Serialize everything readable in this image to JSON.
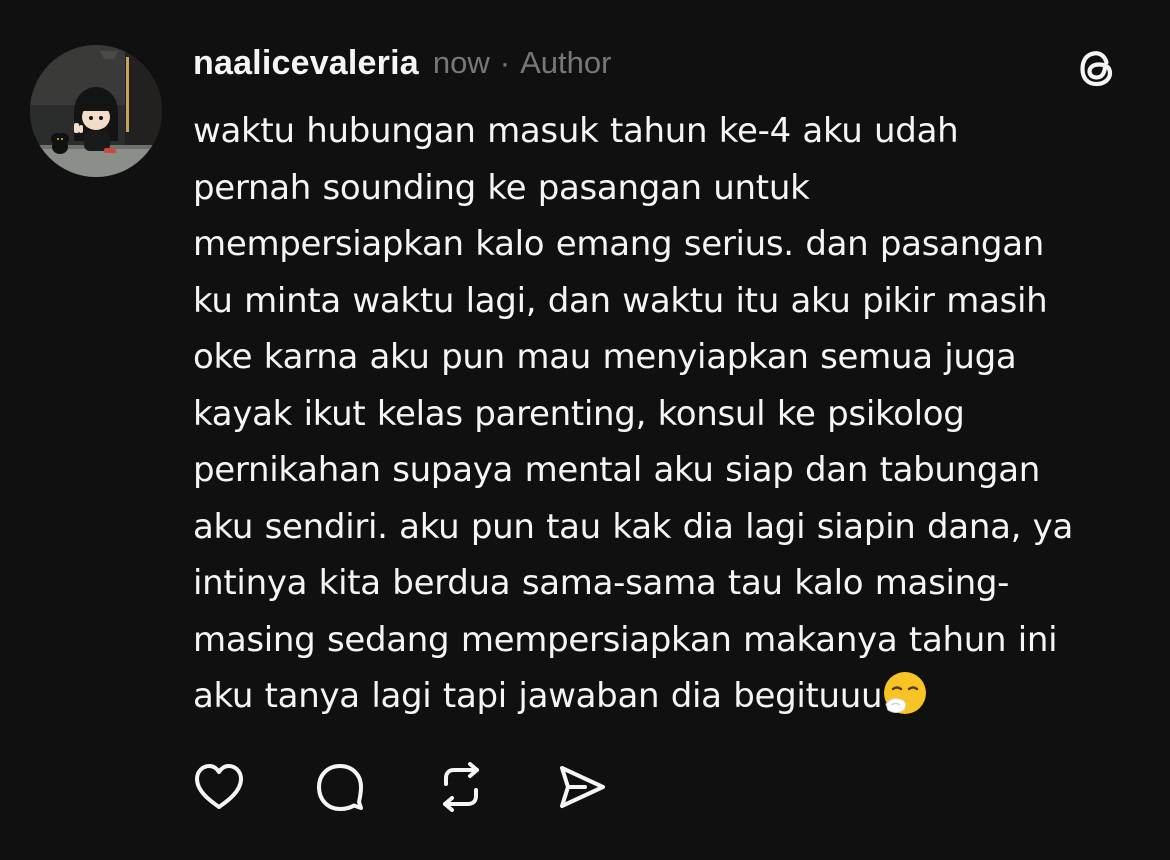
{
  "post": {
    "username": "naalicevaleria",
    "time": "now",
    "separator": "·",
    "badge": "Author",
    "text_lines": [
      "waktu hubungan masuk tahun ke-4 aku udah",
      "pernah sounding ke pasangan untuk",
      "mempersiapkan kalo emang serius. dan pasangan",
      "ku minta waktu lagi, dan waktu itu aku pikir masih",
      "oke karna aku pun mau menyiapkan semua juga",
      "kayak ikut kelas parenting, konsul ke psikolog",
      "pernikahan supaya mental aku siap dan tabungan",
      "aku sendiri. aku pun tau kak dia lagi siapin dana, ya",
      "intinya kita berdua sama-sama tau kalo masing-",
      "masing sedang mempersiapkan makanya tahun ini",
      "aku tanya lagi tapi jawaban dia begituuu"
    ],
    "trailing_emoji": "sneezing-face-emoji"
  },
  "icons": {
    "logo": "threads-logo-icon",
    "like": "heart-icon",
    "reply": "comment-bubble-icon",
    "repost": "repost-icon",
    "share": "send-icon"
  },
  "colors": {
    "background": "#101010",
    "text": "#f3f5f7",
    "muted": "#777777",
    "emoji_yellow": "#f7c325"
  }
}
